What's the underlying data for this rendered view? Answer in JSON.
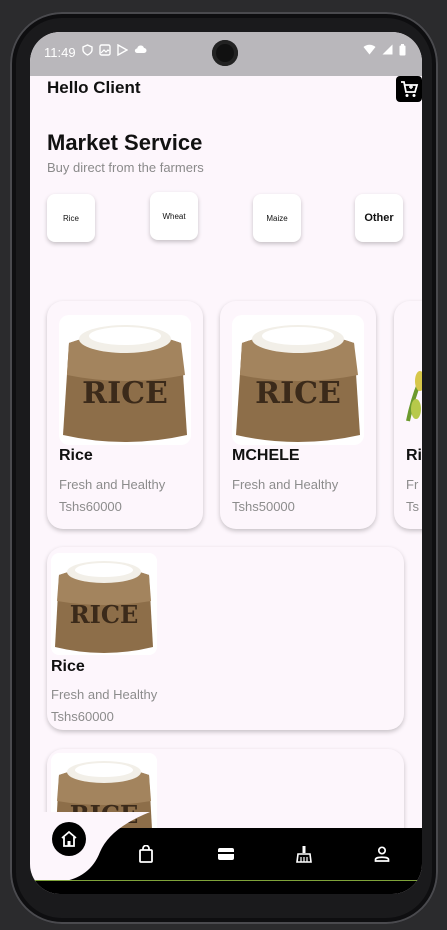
{
  "status_bar": {
    "time": "11:49"
  },
  "header": {
    "greeting": "Hello Client"
  },
  "market": {
    "title": "Market Service",
    "subtitle": "Buy direct from the farmers"
  },
  "categories": [
    {
      "label": "Rice"
    },
    {
      "label": "Wheat"
    },
    {
      "label": "Maize"
    },
    {
      "label": "Other"
    }
  ],
  "featured": [
    {
      "name": "Rice",
      "desc": "Fresh and Healthy",
      "price": "Tshs60000",
      "sack_text": "RICE"
    },
    {
      "name": "MCHELE",
      "desc": "Fresh and Healthy",
      "price": "Tshs50000",
      "sack_text": "RICE"
    },
    {
      "name": "Ri",
      "desc": "Fr",
      "price": "Ts"
    }
  ],
  "list": [
    {
      "name": "Rice",
      "desc": "Fresh and Healthy",
      "price": "Tshs60000",
      "sack_text": "RICE"
    },
    {
      "sack_text": "RICE"
    }
  ],
  "colors": {
    "background": "#fdf6fc",
    "nav": "#000000",
    "accent_line": "#7fa33a"
  },
  "nav_icons": [
    "home-icon",
    "shopping-bag-icon",
    "wallet-icon",
    "broom-icon",
    "person-icon"
  ]
}
